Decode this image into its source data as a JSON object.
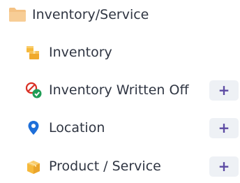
{
  "header": {
    "label": "Inventory/Service",
    "icon": "folder-icon",
    "icon_color": "#f4c284"
  },
  "items": [
    {
      "label": "Inventory",
      "icon": "boxes-icon",
      "has_add": false
    },
    {
      "label": "Inventory Written Off",
      "icon": "written-off-icon",
      "has_add": true,
      "add_label": "+"
    },
    {
      "label": "Location",
      "icon": "location-pin-icon",
      "has_add": true,
      "add_label": "+"
    },
    {
      "label": "Product / Service",
      "icon": "product-box-icon",
      "has_add": true,
      "add_label": "+"
    }
  ],
  "colors": {
    "text": "#2f3542",
    "add_button_bg": "#eef1f5",
    "add_button_fg": "#5c4aa3",
    "pin": "#1e6fd9",
    "check": "#1f9d55",
    "written_off_mark": "#d93025",
    "box": "#f6b93b"
  }
}
